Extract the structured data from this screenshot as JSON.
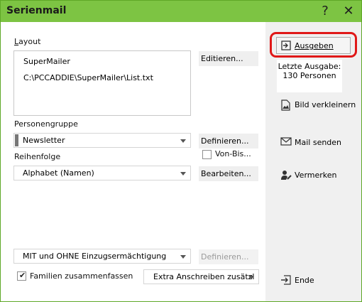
{
  "window": {
    "title": "Serienmail",
    "help": "?",
    "close": "✕"
  },
  "layout": {
    "label": "Layout",
    "items": [
      "SuperMailer",
      "C:\\PCCADDIE\\SuperMailer\\List.txt"
    ],
    "edit_button": "Editieren..."
  },
  "personengruppe": {
    "label": "Personengruppe",
    "value": "Newsletter",
    "define_button": "Definieren...",
    "von_bis": "Von-Bis..."
  },
  "reihenfolge": {
    "label": "Reihenfolge",
    "value": "Alphabet (Namen)",
    "edit_button": "Bearbeiten..."
  },
  "einzug": {
    "value": "MIT und OHNE Einzugsermächtigung",
    "define_button": "Definieren..."
  },
  "familien": {
    "label": "Familien zusammenfassen",
    "checked": true,
    "extra_value": "Extra Anschreiben zusätzl"
  },
  "actions": {
    "ausgeben": "Ausgeben",
    "letzte_ausgabe_line1": "Letzte Ausgabe:",
    "letzte_ausgabe_line2": "130 Personen",
    "bild": "Bild verkleinern",
    "mail": "Mail senden",
    "vermerken": "Vermerken",
    "ende": "Ende"
  },
  "colors": {
    "titlebar": "#7dc443",
    "highlight_ring": "#e01818"
  }
}
